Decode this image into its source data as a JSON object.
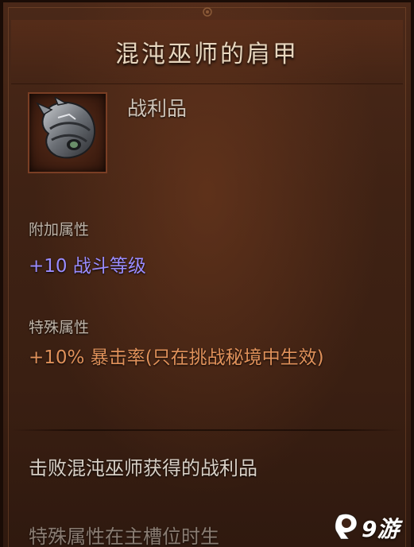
{
  "item": {
    "name": "混沌巫师的肩甲",
    "type": "战利品",
    "icon": "shoulder-armor-icon"
  },
  "sections": {
    "additional": {
      "label": "附加属性",
      "stat": "+10 战斗等级",
      "color": "#9a8cff"
    },
    "special": {
      "label": "特殊属性",
      "stat": "+10% 暴击率(只在挑战秘境中生效)",
      "color": "#e0915a"
    }
  },
  "description": "击败混沌巫师获得的战利品",
  "description_cut": "特殊属性在主槽位时生",
  "watermark": {
    "logo": "9游",
    "icon": "jiuyou-logo-icon"
  },
  "colors": {
    "background": "#3f2214",
    "title": "#e7d6be",
    "frame_border": "#7a3e24"
  }
}
